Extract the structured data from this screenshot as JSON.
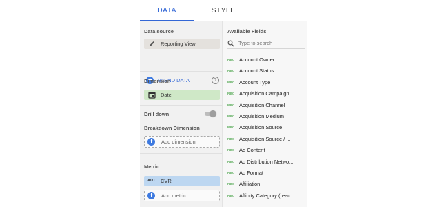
{
  "tabs": {
    "data": "DATA",
    "style": "STYLE"
  },
  "data_source": {
    "title": "Data source",
    "source_name": "Reporting View",
    "blend_label": "BLEND DATA",
    "help_glyph": "?"
  },
  "dimension": {
    "title": "Dimension",
    "value": "Date"
  },
  "drill_down": {
    "label": "Drill down",
    "enabled": false
  },
  "breakdown": {
    "title": "Breakdown Dimension",
    "add_label": "Add dimension"
  },
  "metric": {
    "title": "Metric",
    "aggregation": "AUT",
    "value": "CVR",
    "add_label": "Add metric"
  },
  "available_fields": {
    "title": "Available Fields",
    "search_placeholder": "Type to search",
    "type_badge": "RBC",
    "items": [
      "Account Owner",
      "Account Status",
      "Account Type",
      "Acquisition Campaign",
      "Acquisition Channel",
      "Acquisition Medium",
      "Acquisition Source",
      "Acquisition Source / ...",
      "Ad Content",
      "Ad Distribution Netwo...",
      "Ad Format",
      "Affiliation",
      "Affinity Category (reac..."
    ]
  },
  "colors": {
    "accent": "#3367d6",
    "dimension_chip": "#cfe8c7",
    "metric_chip": "#bdd7f1",
    "source_chip": "#e4e1dd"
  }
}
